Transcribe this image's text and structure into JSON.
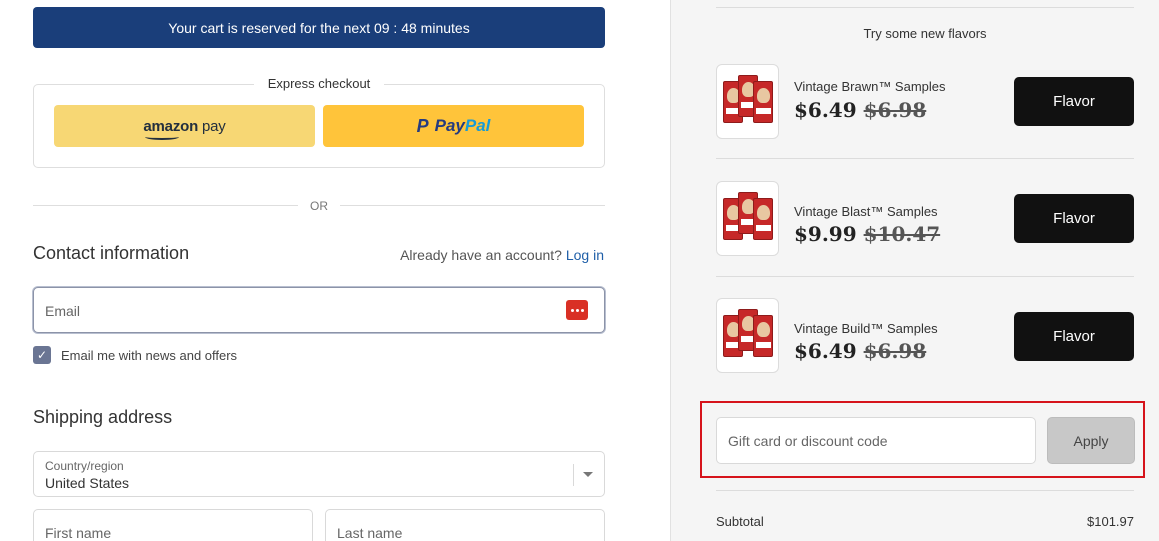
{
  "checkout": {
    "timer_banner": "Your cart is reserved for the next 09 : 48 minutes",
    "express_title": "Express checkout",
    "amazon_pay": {
      "word1": "amazon",
      "word2": "pay"
    },
    "paypal": {
      "word1": "Pay",
      "word2": "Pal"
    },
    "or_label": "OR",
    "contact": {
      "title": "Contact information",
      "account_prompt": "Already have an account?",
      "login_link": "Log in",
      "email_placeholder": "Email",
      "newsletter_label": "Email me with news and offers",
      "newsletter_checked": true
    },
    "shipping": {
      "title": "Shipping address",
      "country_label": "Country/region",
      "country_value": "United States",
      "first_name_placeholder": "First name",
      "last_name_placeholder": "Last name"
    }
  },
  "sidebar": {
    "upsell_title": "Try some new flavors",
    "products": [
      {
        "name": "Vintage Brawn™ Samples",
        "price": "$6.49",
        "compare_price": "$6.98",
        "button": "Flavor"
      },
      {
        "name": "Vintage Blast™ Samples",
        "price": "$9.99",
        "compare_price": "$10.47",
        "button": "Flavor"
      },
      {
        "name": "Vintage Build™ Samples",
        "price": "$6.49",
        "compare_price": "$6.98",
        "button": "Flavor"
      }
    ],
    "discount": {
      "placeholder": "Gift card or discount code",
      "apply_label": "Apply"
    },
    "subtotal": {
      "label": "Subtotal",
      "amount": "$101.97"
    }
  },
  "colors": {
    "banner": "#1a3e7a",
    "amazon_button": "#f7d774",
    "paypal_button": "#ffc43a",
    "flavor_button": "#111111",
    "highlight_border": "#d6131b"
  }
}
